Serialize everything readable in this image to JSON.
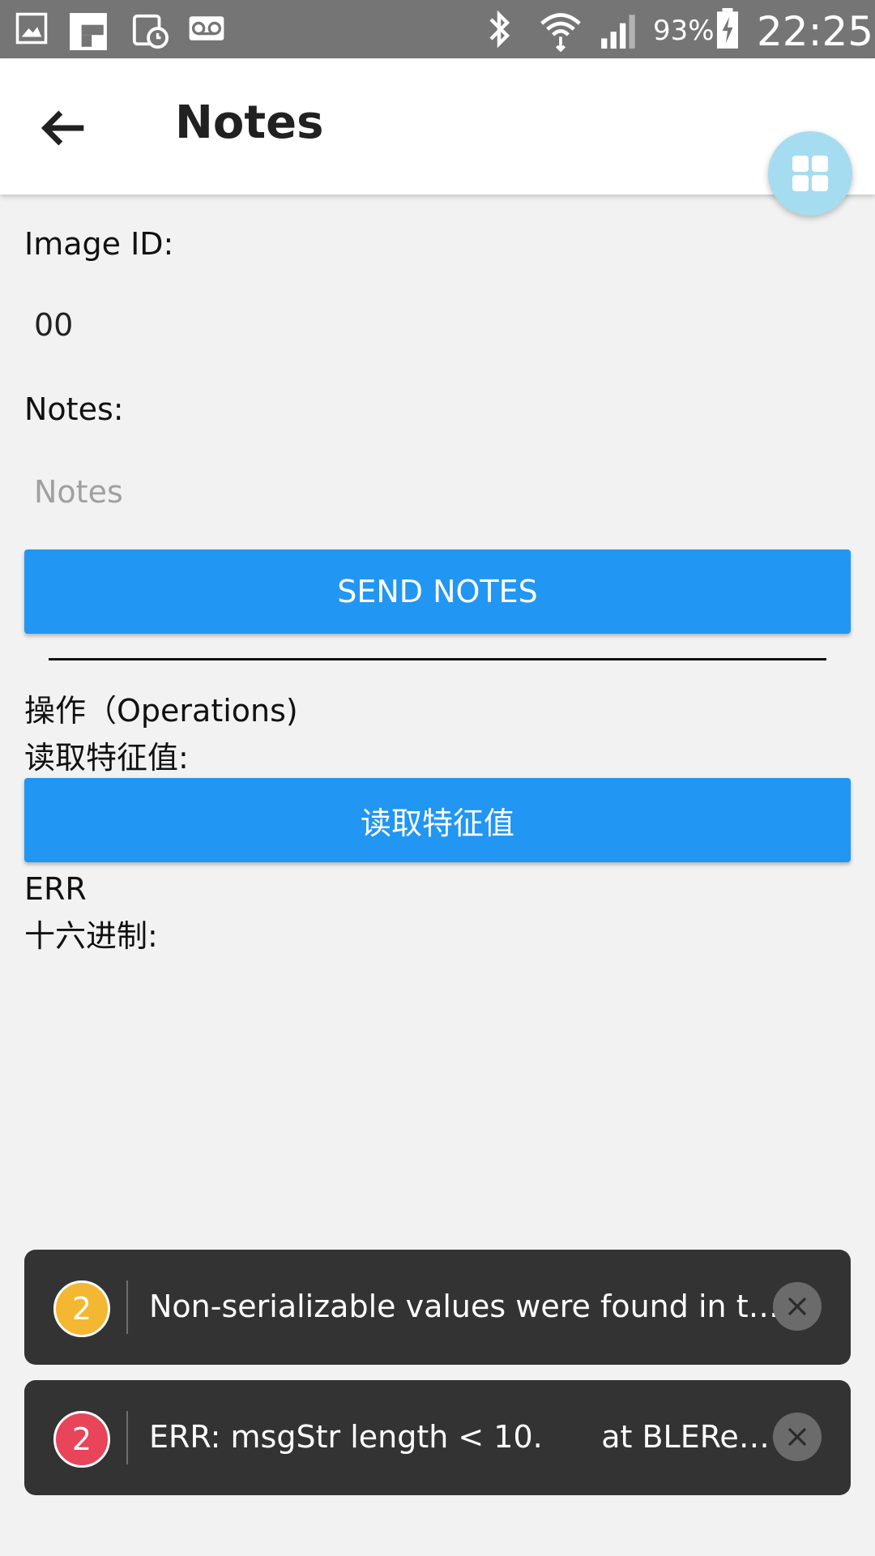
{
  "status_bar": {
    "battery": "93%",
    "time": "22:25",
    "icons": [
      "image-icon",
      "flipboard-icon",
      "calendar-clock-icon",
      "voicemail-icon",
      "bluetooth-icon",
      "wifi-icon",
      "signal-icon",
      "battery-charging-icon"
    ]
  },
  "app_bar": {
    "title": "Notes",
    "back_icon": "arrow-left-icon",
    "fab_icon": "grid-icon",
    "fab_color": "#a6dcf0"
  },
  "form": {
    "image_id_label": "Image ID:",
    "image_id_value": "00",
    "notes_label": "Notes:",
    "notes_placeholder": "Notes",
    "notes_value": "",
    "send_button": "SEND NOTES",
    "button_color": "#2196f3"
  },
  "operations": {
    "heading": "操作（Operations)",
    "read_label": "读取特征值:",
    "read_button": "读取特征值",
    "result": "ERR",
    "hex_label": "十六进制:"
  },
  "toasts": [
    {
      "count": "2",
      "color": "#f4b731",
      "message": "Non-serializable values were found in t…"
    },
    {
      "count": "2",
      "color": "#e8455a",
      "message": "ERR: msgStr length < 10.      at BLERea…"
    }
  ]
}
